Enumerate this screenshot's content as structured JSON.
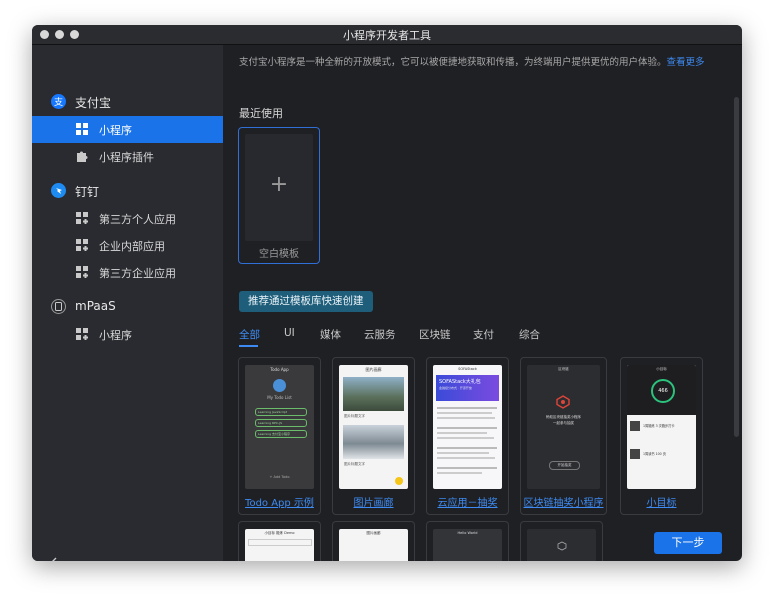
{
  "window": {
    "title": "小程序开发者工具"
  },
  "sidebar": {
    "groups": [
      {
        "label": "支付宝",
        "icon": "alipay-icon",
        "color": "#1677ff",
        "items": [
          {
            "label": "小程序",
            "active": true
          },
          {
            "label": "小程序插件",
            "active": false
          }
        ]
      },
      {
        "label": "钉钉",
        "icon": "dingtalk-icon",
        "color": "#1e8bf2",
        "items": [
          {
            "label": "第三方个人应用"
          },
          {
            "label": "企业内部应用"
          },
          {
            "label": "第三方企业应用"
          }
        ]
      },
      {
        "label": "mPaaS",
        "icon": "mpaas-icon",
        "color": "#9a9a9a",
        "items": [
          {
            "label": "小程序"
          }
        ]
      }
    ]
  },
  "main": {
    "intro_text": "支付宝小程序是一种全新的开放模式，它可以被便捷地获取和传播，为终端用户提供更优的用户体验。",
    "intro_link": "查看更多",
    "recent_title": "最近使用",
    "blank_label": "空白模板",
    "plus": "+",
    "quick_create": "推荐通过模板库快速创建",
    "tabs": [
      "全部",
      "UI",
      "媒体",
      "云服务",
      "区块链",
      "支付",
      "综合"
    ],
    "templates": [
      "Todo App 示例",
      "图片画廊",
      "云应用－抽奖",
      "区块链抽奖小程序",
      "小目标"
    ],
    "next_button": "下一步"
  },
  "mini": {
    "todo": {
      "header": "Todo App",
      "title": "My Todo List",
      "rows": [
        "Learning JavaScript",
        "Learning RPC-JS",
        "Learning 支付宝小程序"
      ],
      "add": "+ Add Todo"
    },
    "gallery": {
      "header": "图片画廊",
      "cap1": "图片标题文字",
      "cap2": "图片标题文字"
    },
    "cloud": {
      "header": "SOFAStack",
      "banner": "SOFAStack大礼包",
      "sub": "金融级分布式 · 开源开放"
    },
    "chain": {
      "header": "区块链",
      "line1": "蚂蚁区块链抽奖小程序",
      "line2": "一起参与抽奖",
      "button": "开始抽奖"
    },
    "goal": {
      "header": "小目标",
      "value": "466",
      "row1": "1周锻炼 3 次跑步打卡",
      "row2": "1周读书 100 页"
    },
    "row2_headers": [
      "小目标 锻炼 Demo",
      "图片画廊",
      "Hello World"
    ]
  }
}
